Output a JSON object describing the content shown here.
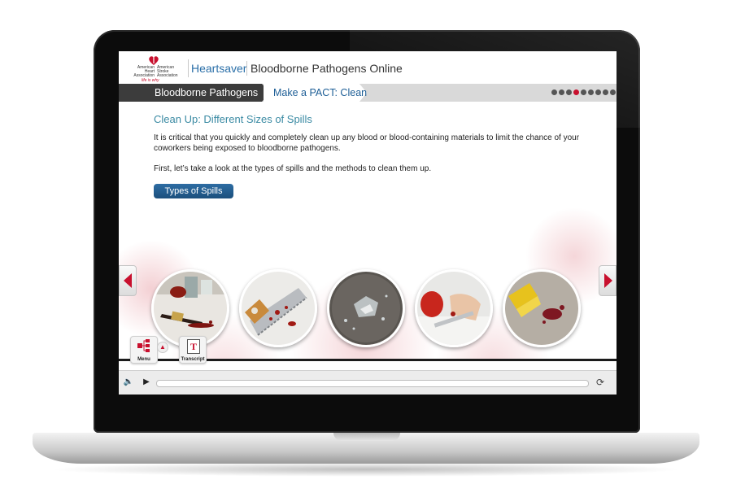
{
  "header": {
    "logo_line1": "American Heart Association",
    "logo_line2": "American Stroke Association",
    "logo_tagline": "life is why",
    "brand": "Heartsaver",
    "course_title": "Bloodborne Pathogens Online"
  },
  "nav": {
    "section": "Bloodborne Pathogens",
    "current": "Make a PACT: Clean",
    "progress_dots_total": 9,
    "progress_dots_active_index": 3
  },
  "content": {
    "title": "Clean Up: Different Sizes of Spills",
    "paragraph1": "It is critical that you quickly and completely clean up any blood or blood-containing materials to limit the chance of your coworkers being exposed to bloodborne pathogens.",
    "paragraph2": "First, let’s take a look at the types of spills and the methods to clean them up.",
    "button": "Types of Spills",
    "thumbnails": [
      "spill-desk",
      "saw-blood",
      "broken-glass",
      "cut-finger",
      "carpet-stain"
    ]
  },
  "toolbar": {
    "menu_label": "Menu",
    "transcript_label": "Transcript",
    "transcript_glyph": "T"
  },
  "player": {
    "volume_icon": "speaker",
    "play_icon": "play",
    "replay_icon": "replay",
    "progress": 0
  },
  "colors": {
    "accent_red": "#c8102e",
    "brand_blue": "#2a6fa8",
    "title_teal": "#3a8aa3",
    "nav_dark": "#3c3c3c"
  }
}
